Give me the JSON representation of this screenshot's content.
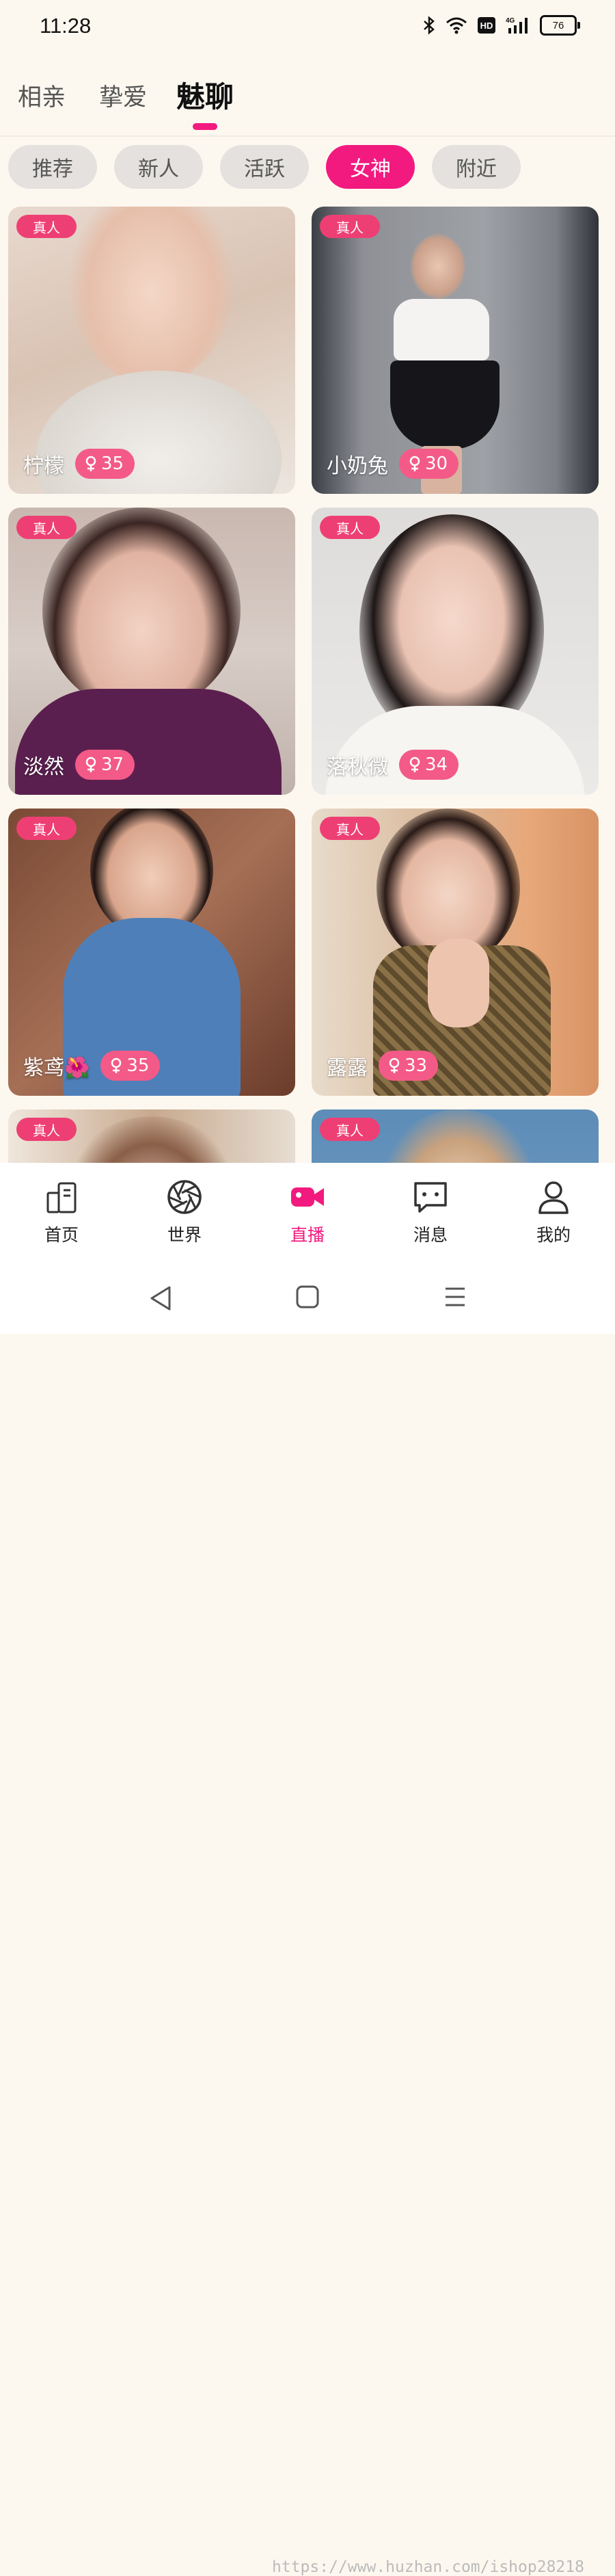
{
  "status_bar": {
    "time": "11:28",
    "battery": "76",
    "network": "4G",
    "hd": "HD"
  },
  "top_tabs": [
    {
      "label": "相亲",
      "active": false
    },
    {
      "label": "挚爱",
      "active": false
    },
    {
      "label": "魅聊",
      "active": true
    }
  ],
  "filter_chips": [
    {
      "label": "推荐",
      "active": false
    },
    {
      "label": "新人",
      "active": false
    },
    {
      "label": "活跃",
      "active": false
    },
    {
      "label": "女神",
      "active": true
    },
    {
      "label": "附近",
      "active": false
    }
  ],
  "cards": [
    {
      "badge": "真人",
      "name": "柠檬",
      "age": "35"
    },
    {
      "badge": "真人",
      "name": "小奶兔",
      "age": "30"
    },
    {
      "badge": "真人",
      "name": "淡然",
      "age": "37"
    },
    {
      "badge": "真人",
      "name": "落秋微",
      "age": "34"
    },
    {
      "badge": "真人",
      "name": "紫鸢🌺",
      "age": "35"
    },
    {
      "badge": "真人",
      "name": "露露",
      "age": "33"
    },
    {
      "badge": "真人",
      "name": "",
      "age": ""
    },
    {
      "badge": "真人",
      "name": "",
      "age": ""
    }
  ],
  "bottom_tabs": [
    {
      "label": "首页",
      "icon": "home-icon",
      "active": false
    },
    {
      "label": "世界",
      "icon": "aperture-icon",
      "active": false
    },
    {
      "label": "直播",
      "icon": "video-camera-icon",
      "active": true
    },
    {
      "label": "消息",
      "icon": "message-icon",
      "active": false
    },
    {
      "label": "我的",
      "icon": "profile-icon",
      "active": false
    }
  ],
  "colors": {
    "accent": "#f21a7f",
    "badge": "#ee3f74",
    "age_pill": "#f35a88",
    "background": "#fdf8ef"
  },
  "watermark": "https://www.huzhan.com/ishop28218"
}
